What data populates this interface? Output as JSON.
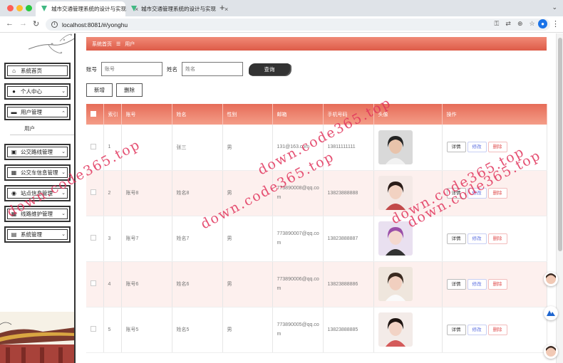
{
  "browser": {
    "tabs": [
      {
        "title": "城市交通管理系统的设计与实现",
        "active": true
      },
      {
        "title": "城市交通管理系统的设计与实现",
        "active": false
      }
    ],
    "url": "localhost:8081/#/yonghu",
    "tab_close": "×",
    "new_tab": "+"
  },
  "sidebar": {
    "items": [
      {
        "label": "系统首页",
        "icon": "home-icon",
        "glyph": "⌂",
        "chevron": ""
      },
      {
        "label": "个人中心",
        "icon": "user-icon",
        "glyph": "●",
        "chevron": "⌄"
      },
      {
        "label": "用户管理",
        "icon": "chat-icon",
        "glyph": "▬",
        "chevron": "⌃"
      },
      {
        "label": "公交路线管理",
        "icon": "briefcase-icon",
        "glyph": "▣",
        "chevron": "⌄"
      },
      {
        "label": "公交车信息管理",
        "icon": "grid-icon",
        "glyph": "▦",
        "chevron": "⌄"
      },
      {
        "label": "站点信息管理",
        "icon": "pin-icon",
        "glyph": "◉",
        "chevron": "⌄"
      },
      {
        "label": "线路维护管理",
        "icon": "grid-icon",
        "glyph": "▦",
        "chevron": "⌄"
      },
      {
        "label": "系统管理",
        "icon": "clipboard-icon",
        "glyph": "▤",
        "chevron": "⌄"
      }
    ],
    "submenu": {
      "label": "用户"
    }
  },
  "breadcrumb": {
    "home": "系统首页",
    "sep": "☰",
    "current": "用户"
  },
  "search": {
    "account_label": "账号",
    "account_placeholder": "账号",
    "name_label": "姓名",
    "name_placeholder": "姓名",
    "query_button": "查询"
  },
  "actions": {
    "add": "新增",
    "delete": "删除"
  },
  "table": {
    "headers": [
      "",
      "索引",
      "账号",
      "姓名",
      "性别",
      "邮箱",
      "手机号码",
      "头像",
      "操作"
    ],
    "rows": [
      {
        "index": "1",
        "account": "",
        "name": "张三",
        "gender": "男",
        "email": "131@163.com",
        "phone": "13811111111"
      },
      {
        "index": "2",
        "account": "账号8",
        "name": "姓名8",
        "gender": "男",
        "email": "773890008@qq.com",
        "phone": "13823888888"
      },
      {
        "index": "3",
        "account": "账号7",
        "name": "姓名7",
        "gender": "男",
        "email": "773890007@qq.com",
        "phone": "13823888887"
      },
      {
        "index": "4",
        "account": "账号6",
        "name": "姓名6",
        "gender": "男",
        "email": "773890006@qq.com",
        "phone": "13823888886"
      },
      {
        "index": "5",
        "account": "账号5",
        "name": "姓名5",
        "gender": "男",
        "email": "773890005@qq.com",
        "phone": "13823888885"
      }
    ],
    "op_detail": "详情",
    "op_edit": "修改",
    "op_delete": "删除"
  },
  "watermark": "down.code365.top",
  "colors": {
    "accent": "#e2604c",
    "accent_light": "#f49d88",
    "row_alt": "#fdf0ee",
    "watermark": "#e0325a"
  }
}
